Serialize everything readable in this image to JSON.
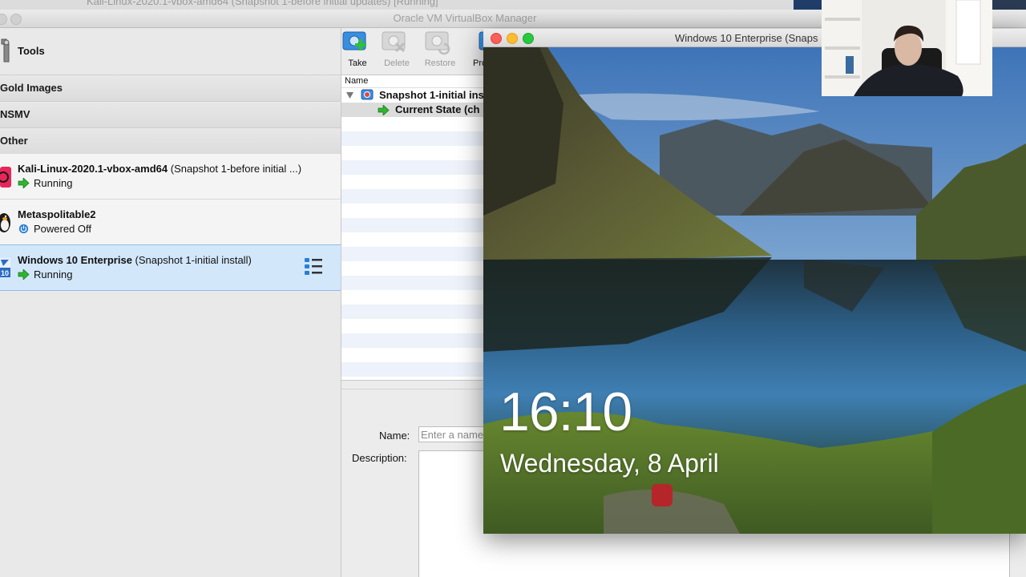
{
  "background_window": {
    "title": "Kali-Linux-2020.1-vbox-amd64 (Snapshot 1-before initial updates) [Running]"
  },
  "manager": {
    "title": "Oracle VM VirtualBox Manager",
    "tools_label": "Tools",
    "groups": [
      "Gold Images",
      "NSMV",
      "Other"
    ],
    "vms": [
      {
        "name": "Kali-Linux-2020.1-vbox-amd64",
        "snapshot": "(Snapshot 1-before initial ...)",
        "status": "Running",
        "status_icon": "running-arrow-icon",
        "os_icon": "kali-os-icon"
      },
      {
        "name": "Metaspolitable2",
        "snapshot": "",
        "status": "Powered Off",
        "status_icon": "power-off-icon",
        "os_icon": "linux-penguin-os-icon"
      },
      {
        "name": "Windows 10 Enterprise",
        "snapshot": "(Snapshot 1-initial install)",
        "status": "Running",
        "status_icon": "running-arrow-icon",
        "os_icon": "windows10-os-icon"
      }
    ],
    "toolbar": {
      "take": "Take",
      "delete": "Delete",
      "restore": "Restore",
      "properties": "Pro"
    },
    "snapshot_tree": {
      "column_header": "Name",
      "snapshot_name": "Snapshot 1-initial ins",
      "current_state": "Current State (ch"
    },
    "details": {
      "name_label": "Name:",
      "name_placeholder": "Enter a name",
      "description_label": "Description:"
    },
    "colors": {
      "selection": "#d3e7fb",
      "running": "#2fb531",
      "accent": "#2a7fd4"
    }
  },
  "vm_window": {
    "title": "Windows 10 Enterprise (Snaps",
    "lock_screen": {
      "time": "16:10",
      "date": "Wednesday, 8 April"
    }
  }
}
